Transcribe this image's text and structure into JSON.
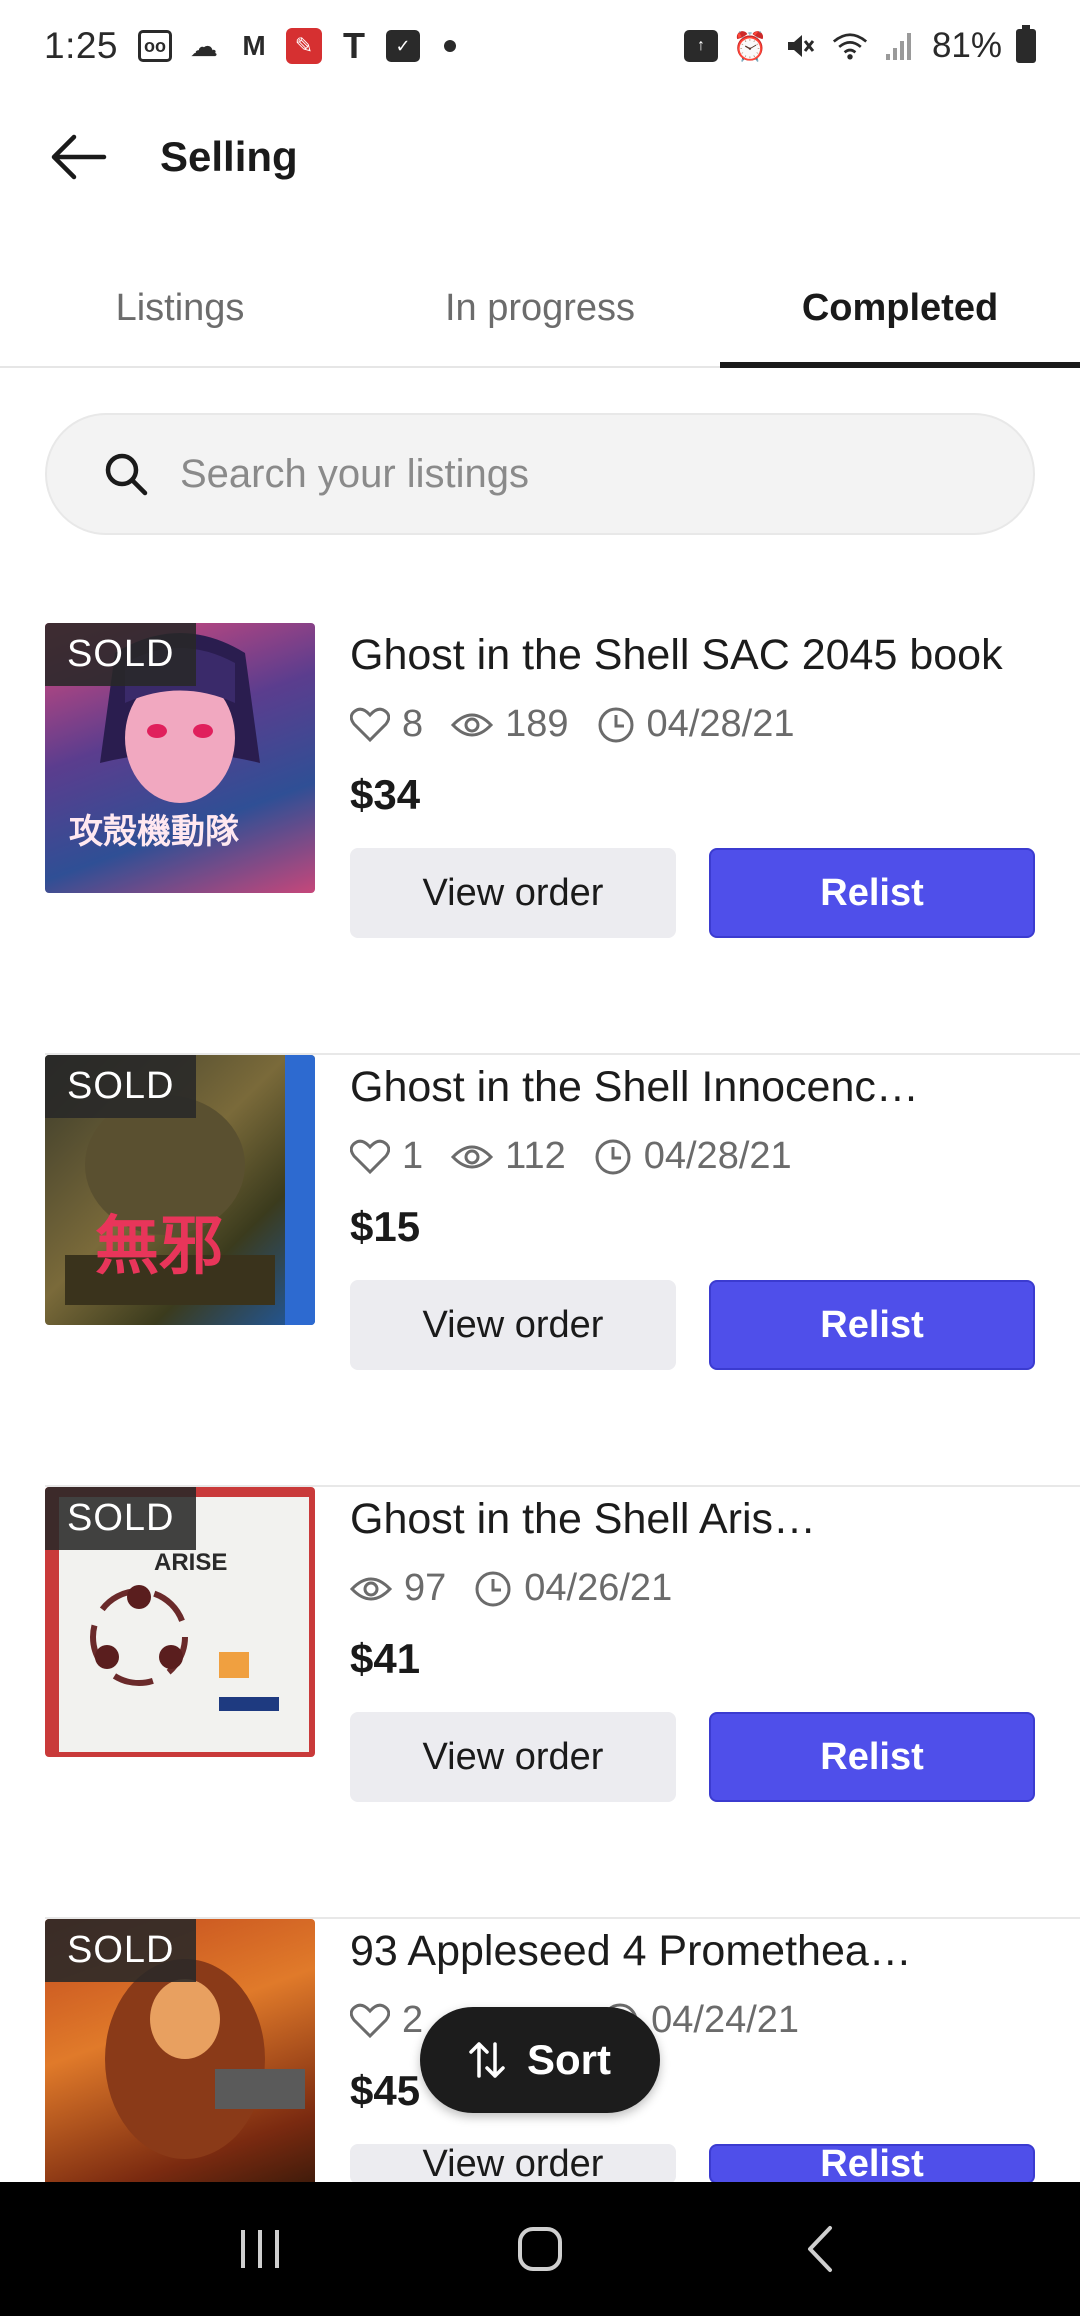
{
  "status_bar": {
    "time": "1:25",
    "battery": "81%",
    "left_icons": [
      "voicemail-icon",
      "messages-icon",
      "gmail-icon",
      "app-icon",
      "tmobile-icon",
      "checkbox-icon"
    ],
    "right_icons": [
      "upload-icon",
      "alarm-icon",
      "mute-icon",
      "wifi-icon",
      "signal-icon",
      "battery-icon"
    ]
  },
  "app_bar": {
    "title": "Selling"
  },
  "tabs": [
    {
      "label": "Listings",
      "active": false
    },
    {
      "label": "In progress",
      "active": false
    },
    {
      "label": "Completed",
      "active": true
    }
  ],
  "search": {
    "placeholder": "Search your listings"
  },
  "listings": [
    {
      "badge": "SOLD",
      "title": "Ghost in the Shell SAC 2045 book",
      "likes": "8",
      "views": "189",
      "date": "04/28/21",
      "price": "$34",
      "view_order_label": "View order",
      "relist_label": "Relist",
      "thumb_text": "攻殻機動隊"
    },
    {
      "badge": "SOLD",
      "title": "Ghost in the Shell Innocenc…",
      "likes": "1",
      "views": "112",
      "date": "04/28/21",
      "price": "$15",
      "view_order_label": "View order",
      "relist_label": "Relist",
      "thumb_text": "無邪"
    },
    {
      "badge": "SOLD",
      "title": "Ghost in the Shell Aris…",
      "views": "97",
      "date": "04/26/21",
      "price": "$41",
      "view_order_label": "View order",
      "relist_label": "Relist",
      "thumb_text": "ARISE"
    },
    {
      "badge": "SOLD",
      "title": "93 Appleseed 4 Promethea…",
      "likes": "2",
      "date": "04/24/21",
      "price": "$45",
      "view_order_label": "View order",
      "relist_label": "Relist"
    }
  ],
  "sort_fab": {
    "label": "Sort"
  },
  "colors": {
    "relist_button": "#4f4fea",
    "view_order_button": "#ececf0",
    "sort_fab": "#1c1c1c"
  }
}
